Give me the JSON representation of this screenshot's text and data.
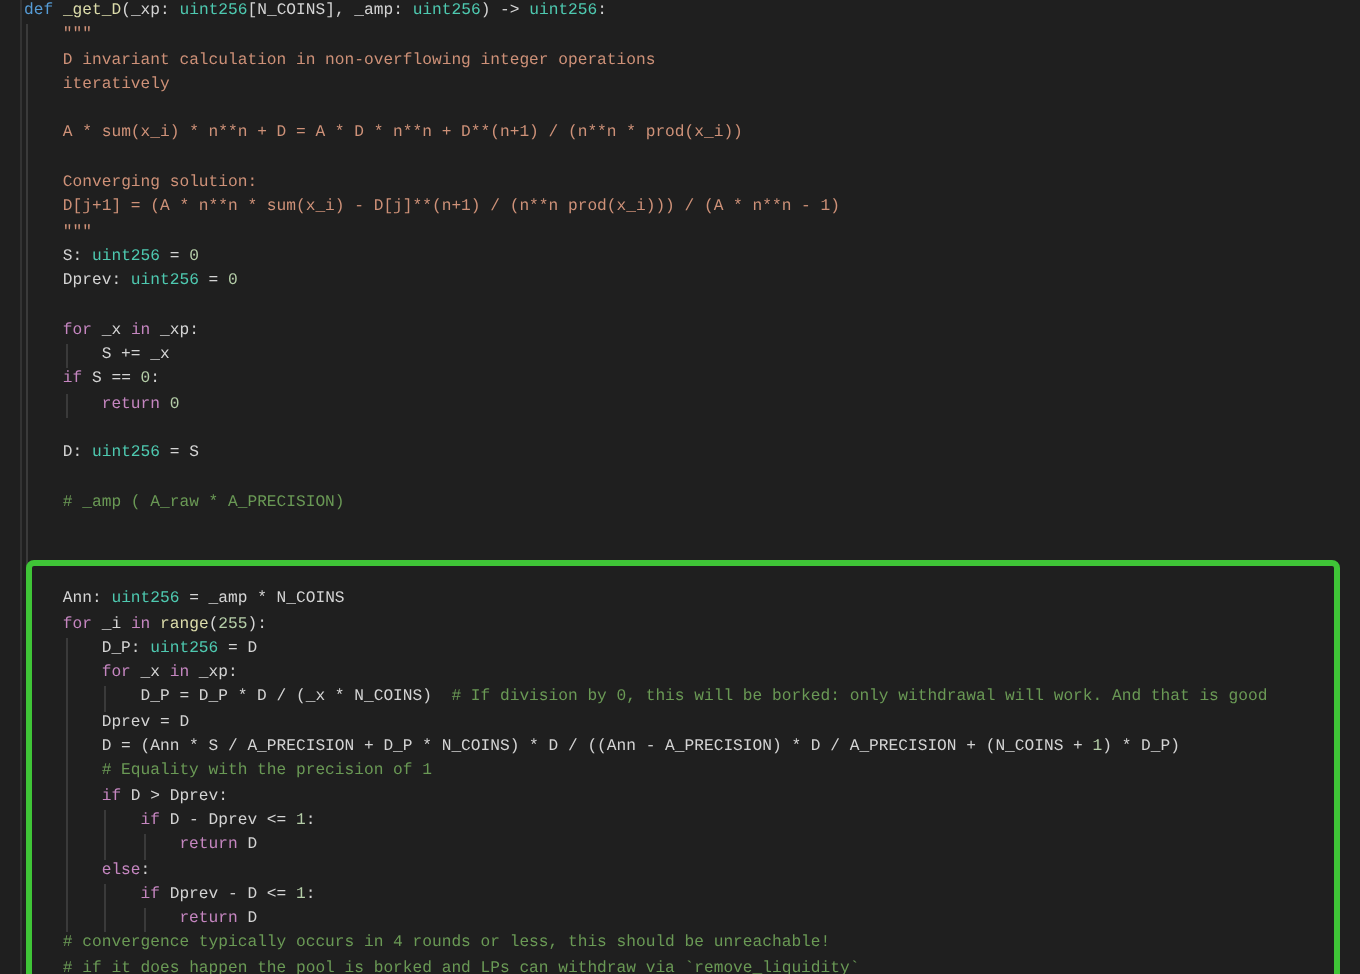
{
  "code": {
    "signature": {
      "tokens": [
        {
          "text": "def ",
          "kind": "definition"
        },
        {
          "text": "_get_D",
          "kind": "function"
        },
        {
          "text": "(_xp: ",
          "kind": "plain"
        },
        {
          "text": "uint256",
          "kind": "type"
        },
        {
          "text": "[N_COINS], _amp: ",
          "kind": "plain"
        },
        {
          "text": "uint256",
          "kind": "type"
        },
        {
          "text": ") -> ",
          "kind": "plain"
        },
        {
          "text": "uint256",
          "kind": "type"
        },
        {
          "text": ":",
          "kind": "plain"
        }
      ]
    },
    "body": [
      {
        "tokens": [
          {
            "text": "\"\"\"",
            "kind": "string"
          }
        ]
      },
      {
        "tokens": [
          {
            "text": "D invariant calculation in non-overflowing integer operations",
            "kind": "string"
          }
        ]
      },
      {
        "tokens": [
          {
            "text": "iteratively",
            "kind": "string"
          }
        ]
      },
      {
        "kind": "blank"
      },
      {
        "tokens": [
          {
            "text": "A * sum(x_i) * n**n + D = A * D * n**n + D**(n+1) / (n**n * prod(x_i))",
            "kind": "string"
          }
        ]
      },
      {
        "kind": "blank"
      },
      {
        "tokens": [
          {
            "text": "Converging solution:",
            "kind": "string"
          }
        ]
      },
      {
        "tokens": [
          {
            "text": "D[j+1] = (A * n**n * sum(x_i) - D[j]**(n+1) / (n**n prod(x_i))) / (A * n**n - 1)",
            "kind": "string"
          }
        ]
      },
      {
        "tokens": [
          {
            "text": "\"\"\"",
            "kind": "string"
          }
        ]
      },
      {
        "tokens": [
          {
            "text": "S: ",
            "kind": "plain"
          },
          {
            "text": "uint256",
            "kind": "type"
          },
          {
            "text": " = ",
            "kind": "plain"
          },
          {
            "text": "0",
            "kind": "number"
          }
        ]
      },
      {
        "tokens": [
          {
            "text": "Dprev: ",
            "kind": "plain"
          },
          {
            "text": "uint256",
            "kind": "type"
          },
          {
            "text": " = ",
            "kind": "plain"
          },
          {
            "text": "0",
            "kind": "number"
          }
        ]
      },
      {
        "kind": "blank"
      },
      {
        "tokens": [
          {
            "text": "for",
            "kind": "keyword"
          },
          {
            "text": " _x ",
            "kind": "plain"
          },
          {
            "text": "in",
            "kind": "keyword"
          },
          {
            "text": " _xp:",
            "kind": "plain"
          }
        ],
        "children": [
          {
            "tokens": [
              {
                "text": "S += _x",
                "kind": "plain"
              }
            ]
          }
        ]
      },
      {
        "tokens": [
          {
            "text": "if",
            "kind": "keyword"
          },
          {
            "text": " S == ",
            "kind": "plain"
          },
          {
            "text": "0",
            "kind": "number"
          },
          {
            "text": ":",
            "kind": "plain"
          }
        ],
        "children": [
          {
            "tokens": [
              {
                "text": "return",
                "kind": "keyword"
              },
              {
                "text": " 0",
                "kind": "number"
              }
            ]
          }
        ]
      },
      {
        "kind": "blank"
      },
      {
        "tokens": [
          {
            "text": "D: ",
            "kind": "plain"
          },
          {
            "text": "uint256",
            "kind": "type"
          },
          {
            "text": " = S",
            "kind": "plain"
          }
        ]
      },
      {
        "kind": "blank"
      },
      {
        "tokens": [
          {
            "text": "# _amp ( A_raw * A_PRECISION)",
            "kind": "comment"
          }
        ]
      }
    ],
    "highlighted": [
      {
        "tokens": [
          {
            "text": "Ann: ",
            "kind": "plain"
          },
          {
            "text": "uint256",
            "kind": "type"
          },
          {
            "text": " = _amp * N_COINS",
            "kind": "plain"
          }
        ]
      },
      {
        "tokens": [
          {
            "text": "for",
            "kind": "keyword"
          },
          {
            "text": " _i ",
            "kind": "plain"
          },
          {
            "text": "in",
            "kind": "keyword"
          },
          {
            "text": " range",
            "kind": "function"
          },
          {
            "text": "(",
            "kind": "plain"
          },
          {
            "text": "255",
            "kind": "number"
          },
          {
            "text": "):",
            "kind": "plain"
          }
        ],
        "children": [
          {
            "tokens": [
              {
                "text": "D_P: ",
                "kind": "plain"
              },
              {
                "text": "uint256",
                "kind": "type"
              },
              {
                "text": " = D",
                "kind": "plain"
              }
            ]
          },
          {
            "tokens": [
              {
                "text": "for",
                "kind": "keyword"
              },
              {
                "text": " _x ",
                "kind": "plain"
              },
              {
                "text": "in",
                "kind": "keyword"
              },
              {
                "text": " _xp:",
                "kind": "plain"
              }
            ],
            "children": [
              {
                "tokens": [
                  {
                    "text": "D_P = D_P * D / (_x * N_COINS)  ",
                    "kind": "plain"
                  },
                  {
                    "text": "# If division by 0, this will be borked: only withdrawal will work. And that is good",
                    "kind": "comment"
                  }
                ]
              }
            ]
          },
          {
            "tokens": [
              {
                "text": "Dprev = D",
                "kind": "plain"
              }
            ]
          },
          {
            "tokens": [
              {
                "text": "D = (Ann * S / A_PRECISION + D_P * N_COINS) * D / ((Ann - A_PRECISION) * D / A_PRECISION + (N_COINS + ",
                "kind": "plain"
              },
              {
                "text": "1",
                "kind": "number"
              },
              {
                "text": ") * D_P)",
                "kind": "plain"
              }
            ]
          },
          {
            "tokens": [
              {
                "text": "# Equality with the precision of 1",
                "kind": "comment"
              }
            ]
          },
          {
            "tokens": [
              {
                "text": "if",
                "kind": "keyword"
              },
              {
                "text": " D > Dprev:",
                "kind": "plain"
              }
            ],
            "children": [
              {
                "tokens": [
                  {
                    "text": "if",
                    "kind": "keyword"
                  },
                  {
                    "text": " D - Dprev <= ",
                    "kind": "plain"
                  },
                  {
                    "text": "1",
                    "kind": "number"
                  },
                  {
                    "text": ":",
                    "kind": "plain"
                  }
                ],
                "children": [
                  {
                    "tokens": [
                      {
                        "text": "return",
                        "kind": "keyword"
                      },
                      {
                        "text": " D",
                        "kind": "plain"
                      }
                    ]
                  }
                ]
              }
            ]
          },
          {
            "tokens": [
              {
                "text": "else",
                "kind": "keyword"
              },
              {
                "text": ":",
                "kind": "plain"
              }
            ],
            "children": [
              {
                "tokens": [
                  {
                    "text": "if",
                    "kind": "keyword"
                  },
                  {
                    "text": " Dprev - D <= ",
                    "kind": "plain"
                  },
                  {
                    "text": "1",
                    "kind": "number"
                  },
                  {
                    "text": ":",
                    "kind": "plain"
                  }
                ],
                "children": [
                  {
                    "tokens": [
                      {
                        "text": "return",
                        "kind": "keyword"
                      },
                      {
                        "text": " D",
                        "kind": "plain"
                      }
                    ]
                  }
                ]
              }
            ]
          }
        ]
      },
      {
        "tokens": [
          {
            "text": "# convergence typically occurs in 4 rounds or less, this should be unreachable!",
            "kind": "comment"
          }
        ]
      },
      {
        "tokens": [
          {
            "text": "# if it does happen the pool is borked and LPs can withdraw via `remove_liquidity`",
            "kind": "comment"
          }
        ]
      }
    ]
  }
}
